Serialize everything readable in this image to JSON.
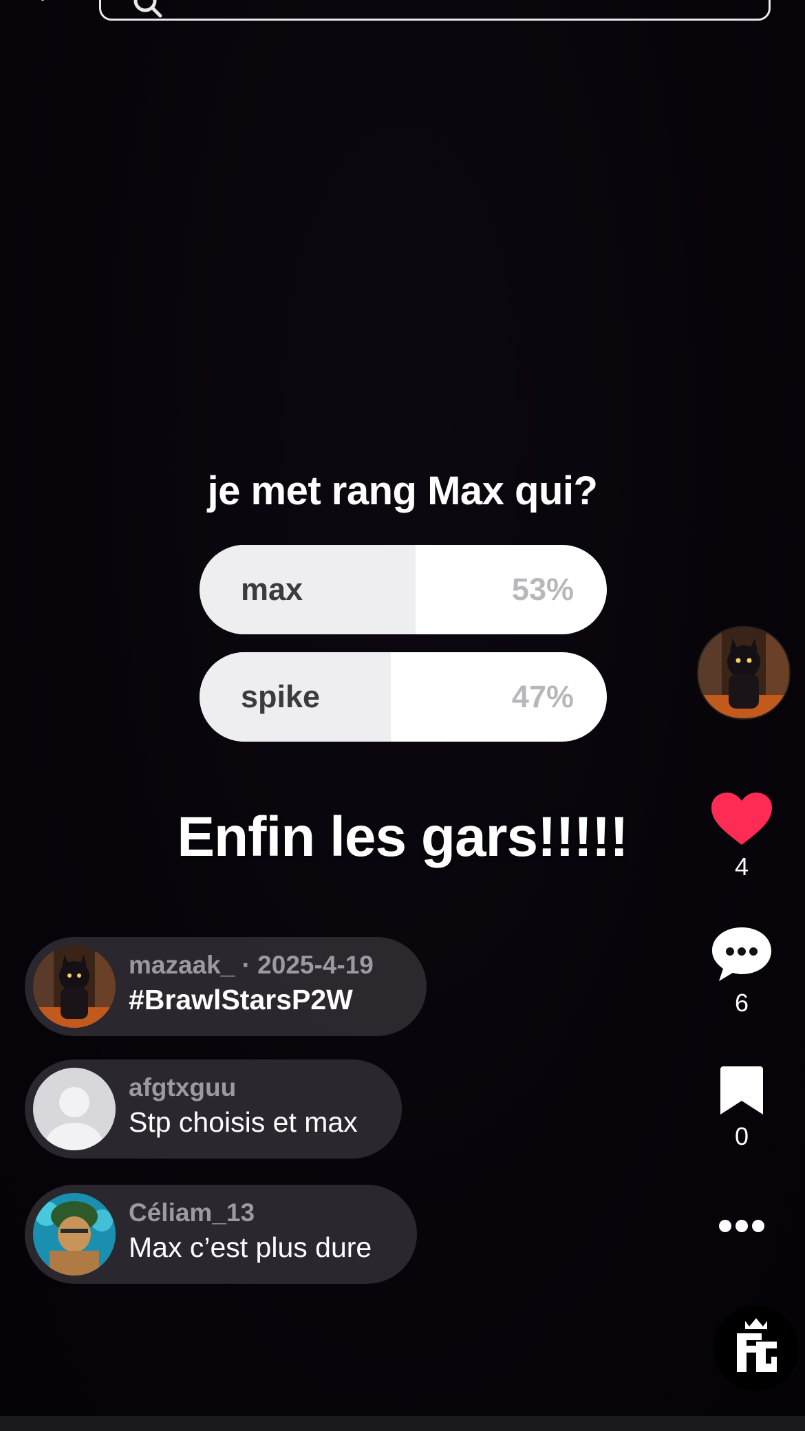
{
  "poll": {
    "question": "je met rang Max qui?",
    "options": [
      {
        "label": "max",
        "percent_text": "53%",
        "fraction": 0.53
      },
      {
        "label": "spike",
        "percent_text": "47%",
        "fraction": 0.47
      }
    ]
  },
  "caption": "Enfin les gars!!!!!",
  "comments": [
    {
      "meta": "mazaak_ · 2025-4-19",
      "text": "#BrawlStarsP2W"
    },
    {
      "meta": "afgtxguu",
      "text": "Stp choisis et max"
    },
    {
      "meta": "Céliam_13",
      "text": "Max c’est plus dure"
    }
  ],
  "sidebar": {
    "like_count": "4",
    "comment_count": "6",
    "bookmark_count": "0"
  },
  "icons": {
    "back": "back-arrow-icon",
    "search": "search-icon",
    "like": "heart-icon",
    "comment": "comment-bubble-icon",
    "bookmark": "bookmark-icon",
    "more": "more-dots-icon",
    "brand": "brand-logo-icon"
  },
  "colors": {
    "like": "#fe2c55",
    "background": "#07040a",
    "poll_fill": "#eeeef0"
  }
}
